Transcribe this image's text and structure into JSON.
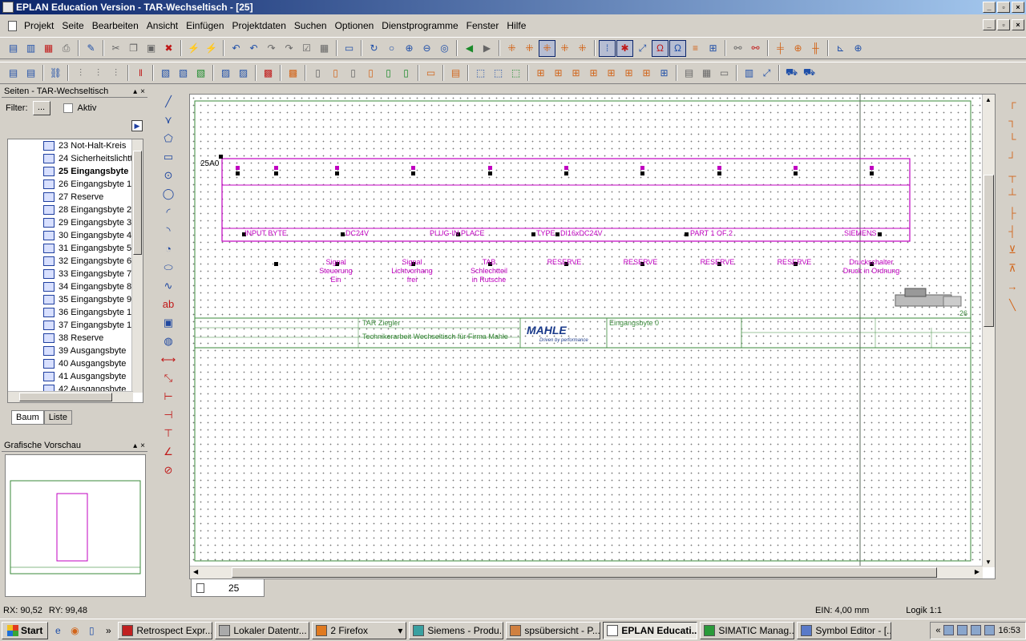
{
  "window": {
    "title": "EPLAN Education Version - TAR-Wechseltisch - [25]"
  },
  "menu": [
    "Projekt",
    "Seite",
    "Bearbeiten",
    "Ansicht",
    "Einfügen",
    "Projektdaten",
    "Suchen",
    "Optionen",
    "Dienstprogramme",
    "Fenster",
    "Hilfe"
  ],
  "pages_panel": {
    "title": "Seiten - TAR-Wechseltisch",
    "filter_label": "Filter:",
    "filter_button": "...",
    "aktiv_label": "Aktiv",
    "items": [
      "23 Not-Halt-Kreis",
      "24 Sicherheitslichtt",
      "25 Eingangsbyte",
      "26 Eingangsbyte 1",
      "27 Reserve",
      "28 Eingangsbyte 2",
      "29 Eingangsbyte 3",
      "30 Eingangsbyte 4",
      "31 Eingangsbyte 5",
      "32 Eingangsbyte 6",
      "33 Eingangsbyte 7",
      "34 Eingangsbyte 8",
      "35 Eingangsbyte 9",
      "36 Eingangsbyte 1",
      "37 Eingangsbyte 1",
      "38 Reserve",
      "39 Ausgangsbyte",
      "40 Ausgangsbyte",
      "41 Ausgangsbyte",
      "42 Ausgangsbyte"
    ],
    "selected_item": "25 Eingangsbyte",
    "tabs": [
      "Baum",
      "Liste"
    ]
  },
  "preview_panel": {
    "title": "Grafische Vorschau"
  },
  "schematic": {
    "device_tag": "25A0",
    "plc_labels": [
      "INPUT BYTE",
      "DC24V",
      "PLUG-IN PLACE",
      "TYPE",
      "DI16xDC24V",
      "PART 1 OF 2",
      "SIEMENS"
    ],
    "signals": [
      [
        "Signal",
        "Steuerung",
        "Ein"
      ],
      [
        "Signal",
        "Lichtvorhang",
        "frei"
      ],
      [
        "TAB",
        "Schlechtteil",
        "in Rutsche"
      ],
      [
        "RESERVE"
      ],
      [
        "RESERVE"
      ],
      [
        "RESERVE"
      ],
      [
        "RESERVE"
      ],
      [
        "Druckschalter",
        "Druck in Ordnung"
      ]
    ],
    "page_number": "26",
    "title_block": {
      "author": "TAR Ziegler",
      "description": "Technikerarbeit Wechseltisch für Firma Mahle",
      "logo_text": "MAHLE",
      "logo_slogan": "Driven by performance",
      "page_title": "Eingangsbyte 0"
    }
  },
  "page_tab": {
    "label": "25"
  },
  "status": {
    "rx": "RX: 90,52",
    "ry": "RY: 99,48",
    "ein": "EIN: 4,00 mm",
    "logik": "Logik 1:1"
  },
  "taskbar": {
    "start": "Start",
    "tasks": [
      "Retrospect Expr...",
      "Lokaler Datentr...",
      "2 Firefox",
      "Siemens - Produ...",
      "spsübersicht - P...",
      "EPLAN Educati...",
      "SIMATIC Manag...",
      "Symbol Editor - [..."
    ],
    "active_task": "EPLAN Educati...",
    "clock": "16:53"
  },
  "colors": {
    "plc_magenta": "#c000c0",
    "title_blue": "#0a246a",
    "grid_green": "#3a8a3a",
    "mahle_blue": "#1a3a8a"
  }
}
